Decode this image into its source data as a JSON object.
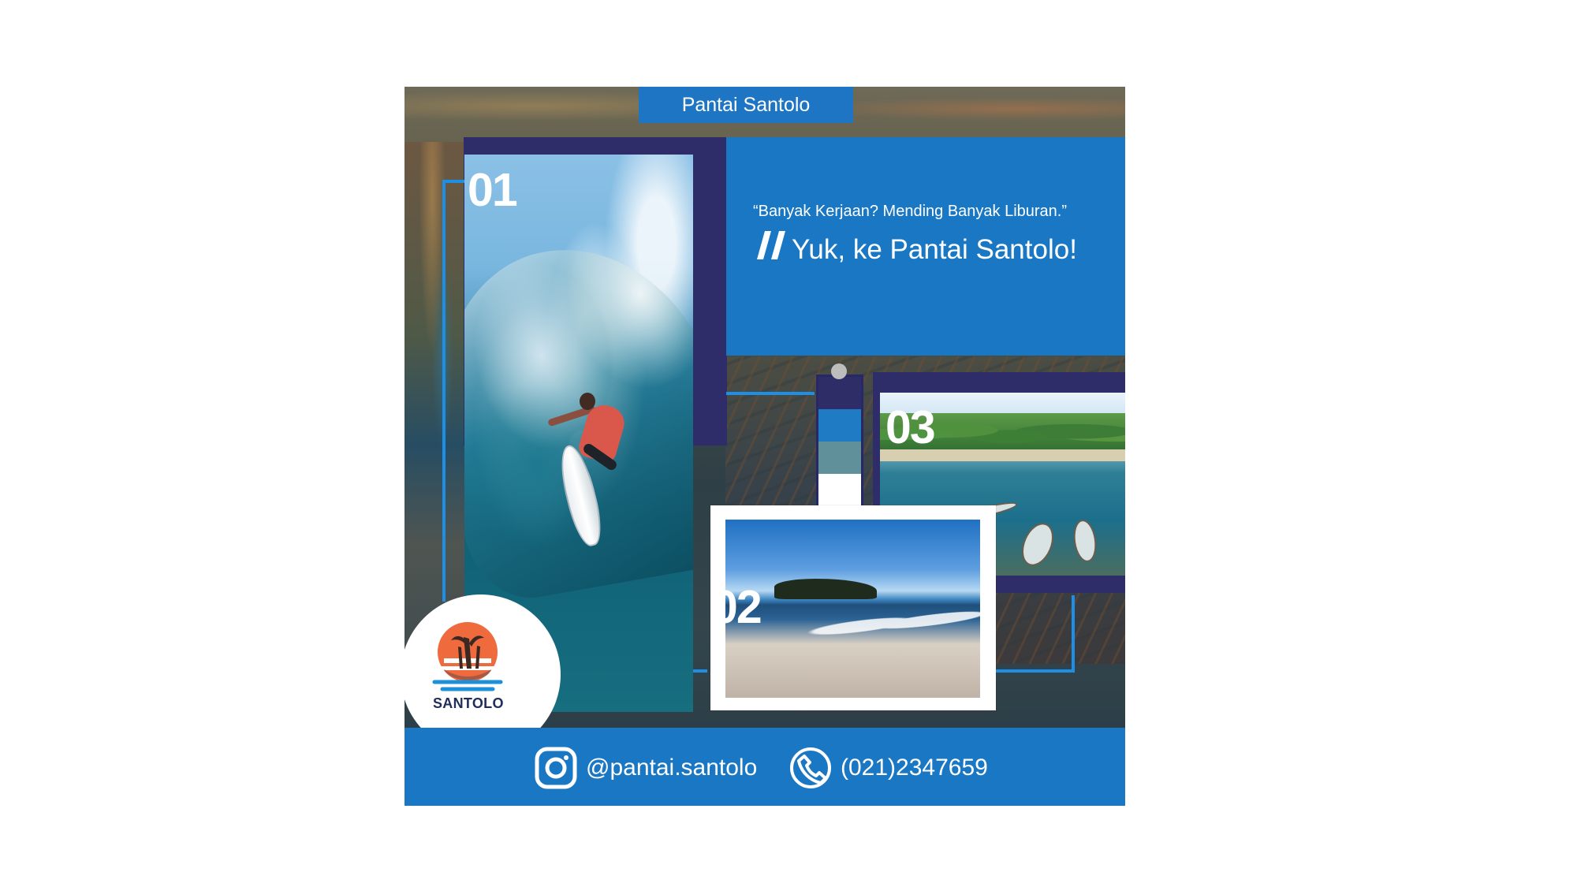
{
  "poster": {
    "title": "Pantai Santolo",
    "quote": "“Banyak Kerjaan? Mending Banyak Liburan.”",
    "cta": "Yuk, ke Pantai Santolo!",
    "photos": [
      {
        "number": "01",
        "scene": "surfer-wave"
      },
      {
        "number": "02",
        "scene": "beach-shore"
      },
      {
        "number": "03",
        "scene": "boats-bay"
      }
    ],
    "logo": {
      "text": "SANTOLO"
    },
    "palette": [
      "#2f2d67",
      "#1f7cc4",
      "#60919b",
      "#ffffff"
    ]
  },
  "footer": {
    "instagram": "@pantai.santolo",
    "phone": "(021)2347659"
  }
}
